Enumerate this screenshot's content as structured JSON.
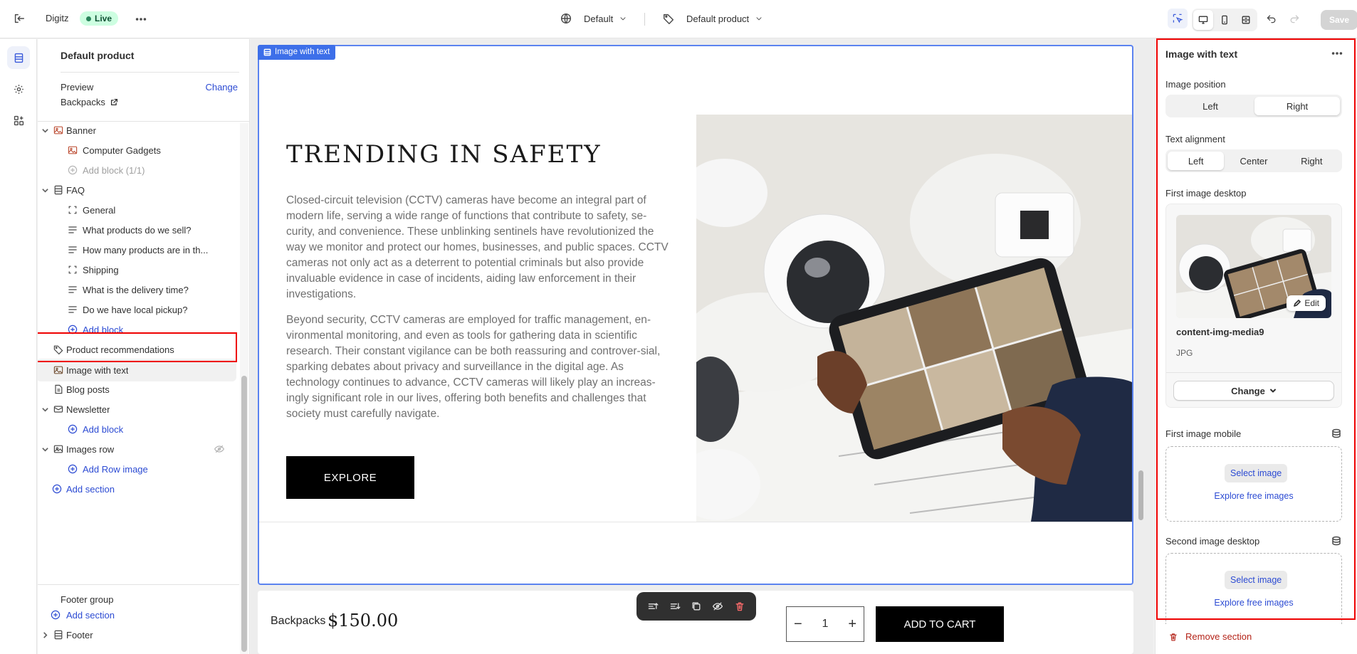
{
  "topbar": {
    "store_name": "Digitz",
    "live_label": "Live",
    "theme_select": "Default",
    "template_select": "Default product",
    "save_label": "Save"
  },
  "sidebar": {
    "title": "Default product",
    "preview_label": "Preview",
    "preview_change": "Change",
    "preview_value": "Backpacks",
    "banner": "Banner",
    "banner_block": "Computer Gadgets",
    "banner_add": "Add block (1/1)",
    "faq": "FAQ",
    "faq_items": [
      "General",
      "What products do we sell?",
      "How many products are in th...",
      "Shipping",
      "What is the delivery time?",
      "Do we have local pickup?"
    ],
    "faq_add": "Add block",
    "product_recs": "Product recommendations",
    "image_with_text": "Image with text",
    "blog_posts": "Blog posts",
    "newsletter": "Newsletter",
    "newsletter_add": "Add block",
    "images_row": "Images row",
    "images_row_add": "Add Row image",
    "add_section": "Add section",
    "footer_group": "Footer group",
    "footer_add_section": "Add section",
    "footer": "Footer"
  },
  "canvas": {
    "section_tag": "Image with text",
    "heading": "TRENDING IN SAFETY",
    "para1": "Closed-circuit television (CCTV) cameras have become an integral part of modern life, serving a wide range of functions that contribute to safety, se-curity, and convenience. These unblinking sentinels have revolutionized the way we monitor and protect our homes, businesses, and public spaces. CCTV cameras not only act as a deterrent to potential criminals but also provide invaluable evidence in case of incidents, aiding law enforcement in their investigations.",
    "para2": "Beyond security, CCTV cameras are employed for traffic management, en-vironmental monitoring, and even as tools for gathering data in scientific research. Their constant vigilance can be both reassuring and controver-sial, sparking debates about privacy and surveillance in the digital age. As technology continues to advance, CCTV cameras will likely play an increas-ingly significant role in our lives, offering both benefits and challenges that society must carefully navigate.",
    "button": "EXPLORE"
  },
  "product_bar": {
    "name": "Backpacks",
    "price": "$150.00",
    "quantity": "1",
    "add_to_cart": "ADD TO CART"
  },
  "right_panel": {
    "title": "Image with text",
    "image_position_label": "Image position",
    "image_position_options": [
      "Left",
      "Right"
    ],
    "text_alignment_label": "Text alignment",
    "text_alignment_options": [
      "Left",
      "Center",
      "Right"
    ],
    "first_image_desktop_label": "First image desktop",
    "file_name": "content-img-media9",
    "file_type": "JPG",
    "edit_label": "Edit",
    "change_label": "Change",
    "first_image_mobile_label": "First image mobile",
    "select_image": "Select image",
    "explore_free": "Explore free images",
    "second_image_desktop_label": "Second image desktop",
    "select_image_2": "Select image",
    "explore_free_2": "Explore free images",
    "remove_section": "Remove section"
  },
  "colors": {
    "accent_blue": "#2c4bd3",
    "frame_blue": "#5b83f0",
    "highlight_red": "#ee0000"
  }
}
